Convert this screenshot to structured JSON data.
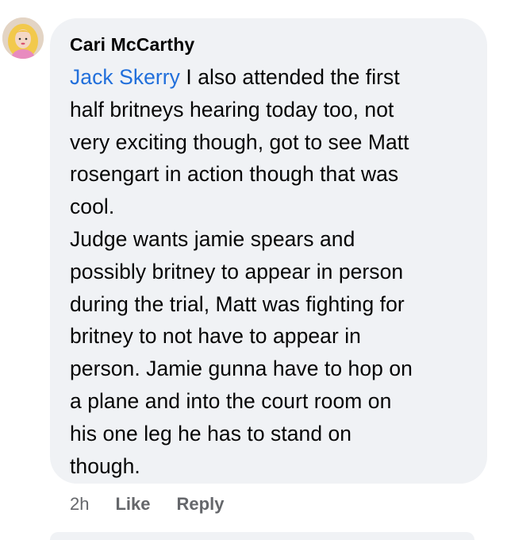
{
  "comment": {
    "author": "Cari McCarthy",
    "mention": "Jack Skerry",
    "body": " I also attended the first\nhalf britneys hearing today too, not\nvery exciting though, got to see Matt\nrosengart in action though that was\ncool.\nJudge wants jamie spears and\npossibly britney to appear in person\nduring the trial, Matt was fighting for\nbritney to not have to appear in\nperson. Jamie gunna have to hop on\na plane and into the court room on\nhis one leg he has to stand on\nthough.",
    "timestamp": "2h",
    "like_label": "Like",
    "reply_label": "Reply"
  },
  "colors": {
    "bubble_bg": "#f0f2f5",
    "mention": "#216fdb",
    "text": "#050505",
    "secondary_text": "#65676b"
  },
  "icons": {
    "avatar": "user-avatar-photo"
  }
}
